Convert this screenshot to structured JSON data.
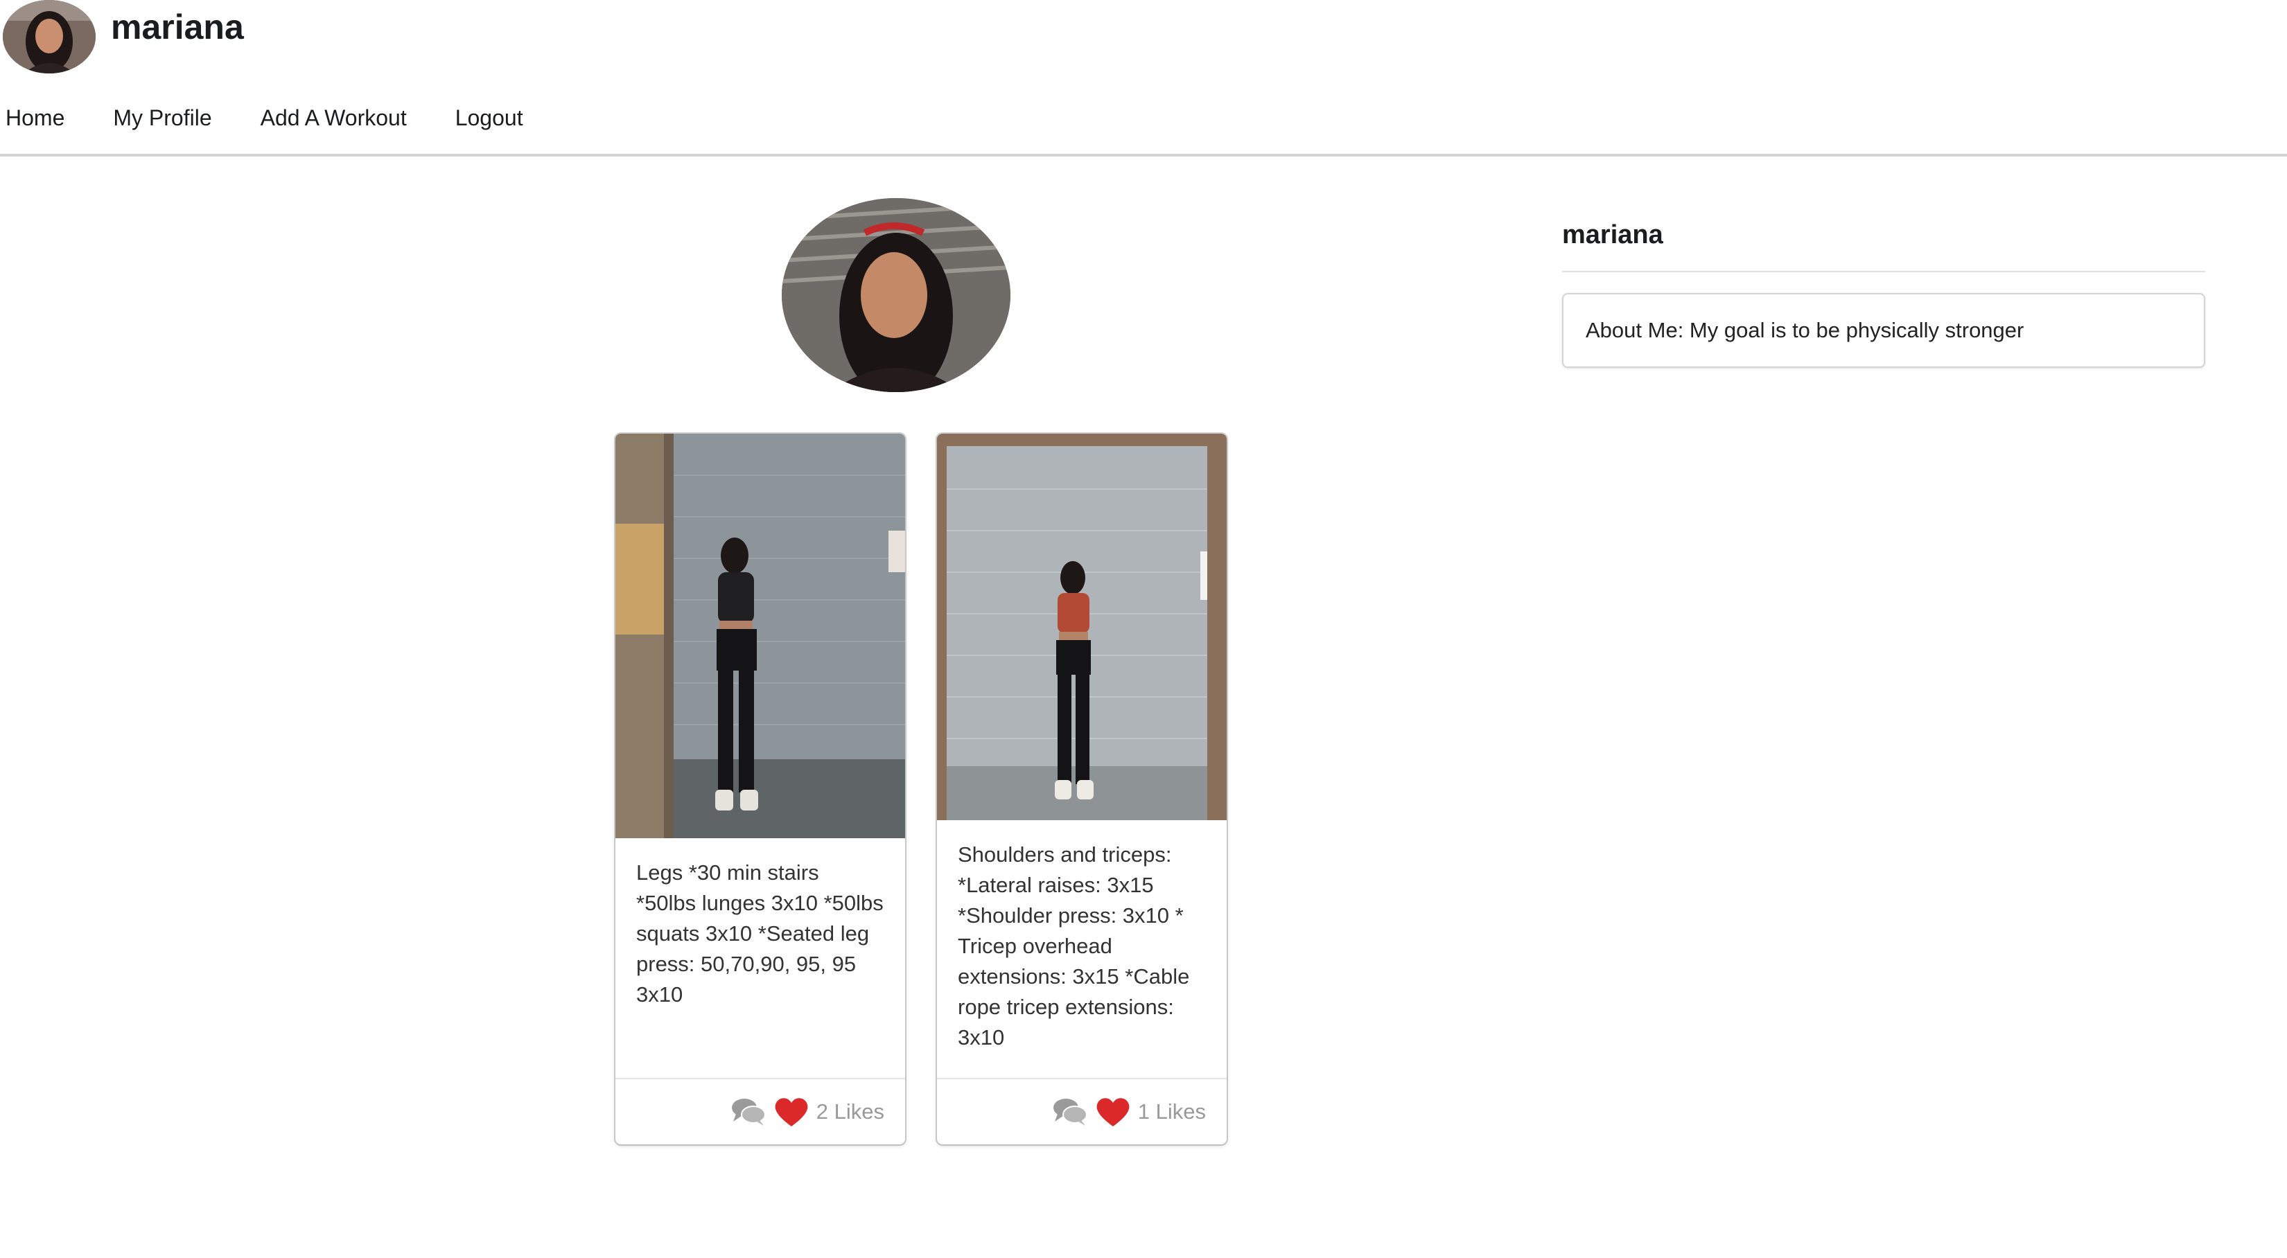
{
  "header": {
    "username": "mariana",
    "nav": [
      "Home",
      "My Profile",
      "Add A Workout",
      "Logout"
    ]
  },
  "profile": {
    "name": "mariana",
    "about": "About Me: My goal is to be physically stronger"
  },
  "workouts": [
    {
      "text": "Legs *30 min stairs *50lbs lunges 3x10 *50lbs squats 3x10 *Seated leg press: 50,70,90, 95, 95 3x10",
      "likes_label": "2 Likes"
    },
    {
      "text": "Shoulders and triceps: *Lateral raises: 3x15 *Shoulder press: 3x10 * Tricep overhead extensions: 3x15 *Cable rope tricep extensions: 3x10",
      "likes_label": "1 Likes"
    }
  ],
  "icons": {
    "comment": "comments-icon",
    "like": "heart-icon"
  },
  "colors": {
    "heart": "#db2828",
    "comment": "#9a9a9a",
    "divider": "#d4d4d5"
  }
}
